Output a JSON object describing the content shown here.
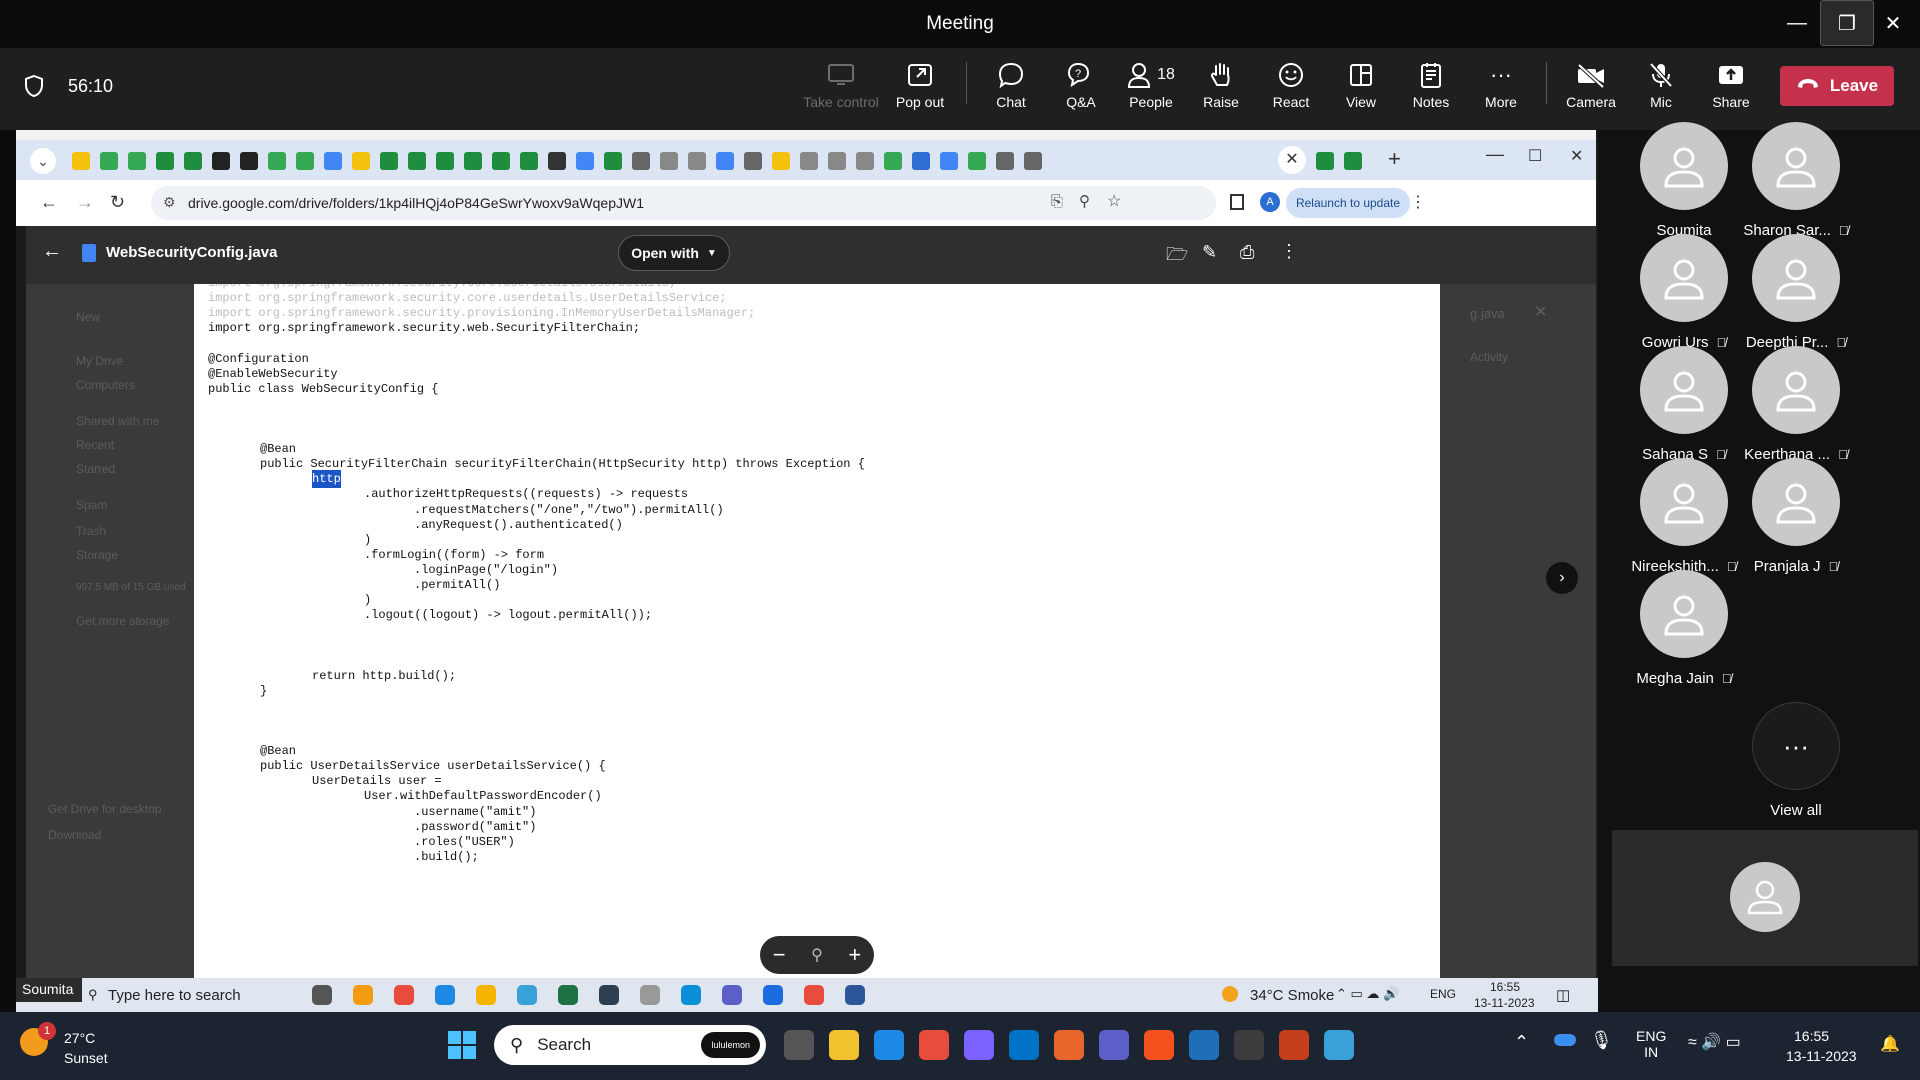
{
  "app": {
    "title": "Meeting",
    "timer": "56:10"
  },
  "toolbar": {
    "take_control": "Take control",
    "pop_out": "Pop out",
    "chat": "Chat",
    "qa": "Q&A",
    "people": "People",
    "people_count": "18",
    "raise": "Raise",
    "react": "React",
    "view": "View",
    "notes": "Notes",
    "more": "More",
    "camera": "Camera",
    "mic": "Mic",
    "share": "Share",
    "leave": "Leave"
  },
  "browser": {
    "url": "drive.google.com/drive/folders/1kp4ilHQj4oP84GeSwrYwoxv9aWqepJW1",
    "relaunch": "Relaunch to update",
    "profile_initial": "A"
  },
  "drive": {
    "filename": "WebSecurityConfig.java",
    "open_with": "Open with",
    "bg_left": [
      "New",
      "My Drive",
      "Computers",
      "Shared with me",
      "Recent",
      "Starred",
      "Spam",
      "Trash",
      "Storage",
      "997.5 MB of 15 GB used",
      "Get more storage",
      "Get Drive for desktop",
      "Download"
    ],
    "bg_right": [
      "g.java",
      "Activity"
    ]
  },
  "code_lines": [
    {
      "t": "import org.springframework.security.core.userdetails.UserDetails;",
      "faded": true,
      "indent": 0
    },
    {
      "t": "import org.springframework.security.core.userdetails.UserDetailsService;",
      "faded": true,
      "indent": 0
    },
    {
      "t": "import org.springframework.security.provisioning.InMemoryUserDetailsManager;",
      "faded": true,
      "indent": 0
    },
    {
      "t": "import org.springframework.security.web.SecurityFilterChain;",
      "faded": false,
      "indent": 0
    },
    {
      "t": "",
      "faded": false,
      "indent": 0
    },
    {
      "t": "@Configuration",
      "faded": false,
      "indent": 0
    },
    {
      "t": "@EnableWebSecurity",
      "faded": false,
      "indent": 0
    },
    {
      "t": "public class WebSecurityConfig {",
      "faded": false,
      "indent": 0
    },
    {
      "t": "",
      "faded": false,
      "indent": 0
    },
    {
      "t": "",
      "faded": false,
      "indent": 0
    },
    {
      "t": "",
      "faded": false,
      "indent": 0
    },
    {
      "t": "@Bean",
      "faded": false,
      "indent": 1
    },
    {
      "t": "public SecurityFilterChain securityFilterChain(HttpSecurity http) throws Exception {",
      "faded": false,
      "indent": 1
    },
    {
      "t": "http",
      "faded": false,
      "indent": 2,
      "highlight": true
    },
    {
      "t": ".authorizeHttpRequests((requests) -> requests",
      "faded": false,
      "indent": 3
    },
    {
      "t": ".requestMatchers(\"/one\",\"/two\").permitAll()",
      "faded": false,
      "indent": 4
    },
    {
      "t": ".anyRequest().authenticated()",
      "faded": false,
      "indent": 4
    },
    {
      "t": ")",
      "faded": false,
      "indent": 3
    },
    {
      "t": ".formLogin((form) -> form",
      "faded": false,
      "indent": 3
    },
    {
      "t": ".loginPage(\"/login\")",
      "faded": false,
      "indent": 4
    },
    {
      "t": ".permitAll()",
      "faded": false,
      "indent": 4
    },
    {
      "t": ")",
      "faded": false,
      "indent": 3
    },
    {
      "t": ".logout((logout) -> logout.permitAll());",
      "faded": false,
      "indent": 3
    },
    {
      "t": "",
      "faded": false,
      "indent": 0
    },
    {
      "t": "",
      "faded": false,
      "indent": 0
    },
    {
      "t": "",
      "faded": false,
      "indent": 0
    },
    {
      "t": "return http.build();",
      "faded": false,
      "indent": 2
    },
    {
      "t": "}",
      "faded": false,
      "indent": 1
    },
    {
      "t": "",
      "faded": false,
      "indent": 0
    },
    {
      "t": "",
      "faded": false,
      "indent": 0
    },
    {
      "t": "",
      "faded": false,
      "indent": 0
    },
    {
      "t": "@Bean",
      "faded": false,
      "indent": 1
    },
    {
      "t": "public UserDetailsService userDetailsService() {",
      "faded": false,
      "indent": 1
    },
    {
      "t": "UserDetails user =",
      "faded": false,
      "indent": 2
    },
    {
      "t": "User.withDefaultPasswordEncoder()",
      "faded": false,
      "indent": 3
    },
    {
      "t": ".username(\"amit\")",
      "faded": false,
      "indent": 4
    },
    {
      "t": ".password(\"amit\")",
      "faded": false,
      "indent": 4
    },
    {
      "t": ".roles(\"USER\")",
      "faded": false,
      "indent": 4
    },
    {
      "t": ".build();",
      "faded": false,
      "indent": 4
    }
  ],
  "inner_taskbar": {
    "presenter": "Soumita",
    "search_placeholder": "Type here to search",
    "weather": "34°C  Smoke",
    "lang": "ENG",
    "time": "16:55",
    "date": "13-11-2023"
  },
  "participants": [
    {
      "name": "Soumita",
      "muted": false
    },
    {
      "name": "Sharon Sar...",
      "muted": true
    },
    {
      "name": "Gowri Urs",
      "muted": true
    },
    {
      "name": "Deepthi Pr...",
      "muted": true
    },
    {
      "name": "Sahana S",
      "muted": true
    },
    {
      "name": "Keerthana ...",
      "muted": true
    },
    {
      "name": "Nireekshith...",
      "muted": true
    },
    {
      "name": "Pranjala J",
      "muted": true
    },
    {
      "name": "Megha Jain",
      "muted": true
    }
  ],
  "view_all": "View all",
  "taskbar": {
    "weather_temp": "27°C",
    "weather_desc": "Sunset",
    "weather_badge": "1",
    "search": "Search",
    "search_badge": "lululemon",
    "lang_line1": "ENG",
    "lang_line2": "IN",
    "time": "16:55",
    "date": "13-11-2023"
  },
  "colors": {
    "leave": "#c4314b",
    "highlight": "#1a56c8",
    "teams_bar": "#1f1f1f"
  }
}
